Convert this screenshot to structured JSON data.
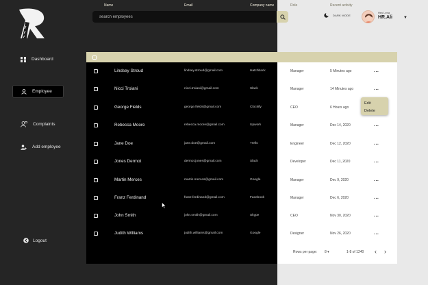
{
  "sidebar": {
    "items": [
      {
        "label": "Dashboard",
        "icon": "dashboard-icon",
        "active": false
      },
      {
        "label": "Employee",
        "icon": "user-icon",
        "active": true
      },
      {
        "label": "Complaints",
        "icon": "complaints-icon",
        "active": false
      },
      {
        "label": "Add employee",
        "icon": "add-user-icon",
        "active": false
      }
    ],
    "logout_label": "Logout"
  },
  "search": {
    "placeholder": "search employees"
  },
  "header": {
    "dark_mode_label": "DARK MODE",
    "greeting": "Hey Lena",
    "user_name": "HR.Ali"
  },
  "table": {
    "columns": [
      "Name",
      "Email",
      "Company name",
      "Role",
      "Recent activity"
    ],
    "rows": [
      {
        "name": "Lindsey Stroud",
        "email": "lindsey.stroud@gmail.com",
        "company": "Hatchback",
        "role": "Manager",
        "activity": "5 Minutes ago"
      },
      {
        "name": "Nicci Troiani",
        "email": "nicci.troiani@gmail.com",
        "company": "Slack",
        "role": "Manager",
        "activity": "14 Minutes ago"
      },
      {
        "name": "George Fields",
        "email": "george.fields@gmail.com",
        "company": "Clockify",
        "role": "CEO",
        "activity": "6 Hours ago"
      },
      {
        "name": "Rebecca Moore",
        "email": "rebecca.moore@gmail.com",
        "company": "Upwork",
        "role": "Manager",
        "activity": "Dec 14, 2020"
      },
      {
        "name": "Jane Doe",
        "email": "jane.doe@gmail.com",
        "company": "Trello",
        "role": "Engineer",
        "activity": "Dec 12, 2020"
      },
      {
        "name": "Jones Dermot",
        "email": "dermot.jones@gmail.com",
        "company": "Slack",
        "role": "Developer",
        "activity": "Dec 11, 2020"
      },
      {
        "name": "Martin Merces",
        "email": "martin.merces@gmail.com",
        "company": "Google",
        "role": "Manager",
        "activity": "Dec 9, 2020"
      },
      {
        "name": "Franz Ferdinand",
        "email": "franz.ferdinand@gmail.com",
        "company": "Facebook",
        "role": "Manager",
        "activity": "Dec 6, 2020"
      },
      {
        "name": "John Smith",
        "email": "john.smith@gmail.com",
        "company": "Skype",
        "role": "CEO",
        "activity": "Nov 30, 2020"
      },
      {
        "name": "Judith Williams",
        "email": "judith.williams@gmail.com",
        "company": "Google",
        "role": "Designer",
        "activity": "Nov 26, 2020"
      }
    ],
    "more_label": "..."
  },
  "context_menu": {
    "items": [
      "Edit",
      "Delete"
    ]
  },
  "pagination": {
    "rows_per_page_label": "Rows per page:",
    "rows_per_page_value": "8",
    "range": "1-8 of 1240",
    "prev": "‹",
    "next": "›"
  },
  "colors": {
    "accent": "#d7d2ad",
    "dark_bg": "#252525",
    "light_bg": "#e9e9e9",
    "table_dark": "#000000",
    "table_light": "#ffffff"
  }
}
